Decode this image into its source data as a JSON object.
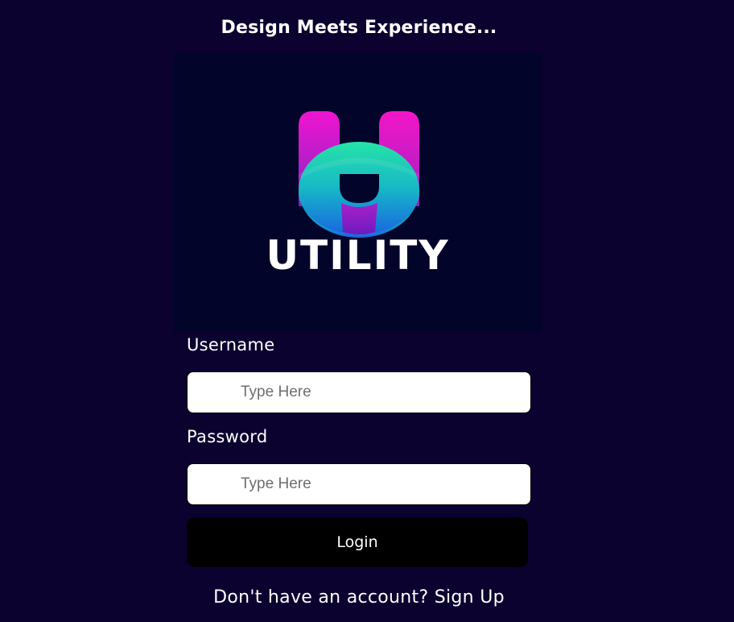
{
  "header": {
    "tagline": "Design Meets Experience..."
  },
  "logo": {
    "icon": "u-letter-logo-icon",
    "wordmark": "UTILITY",
    "colors": {
      "magenta": "#e814c8",
      "purple": "#8a1fc2",
      "teal": "#20d8a8",
      "blue": "#1a6fe0"
    }
  },
  "form": {
    "username_label": "Username",
    "username_placeholder": "Type Here",
    "password_label": "Password",
    "password_placeholder": "Type Here",
    "login_label": "Login"
  },
  "footer": {
    "prompt_text": "Don't have an account?",
    "signup_link": "Sign Up"
  },
  "theme": {
    "background": "#0b0230",
    "logo_panel": "#02042a",
    "button": "#000000",
    "input": "#ffffff"
  }
}
